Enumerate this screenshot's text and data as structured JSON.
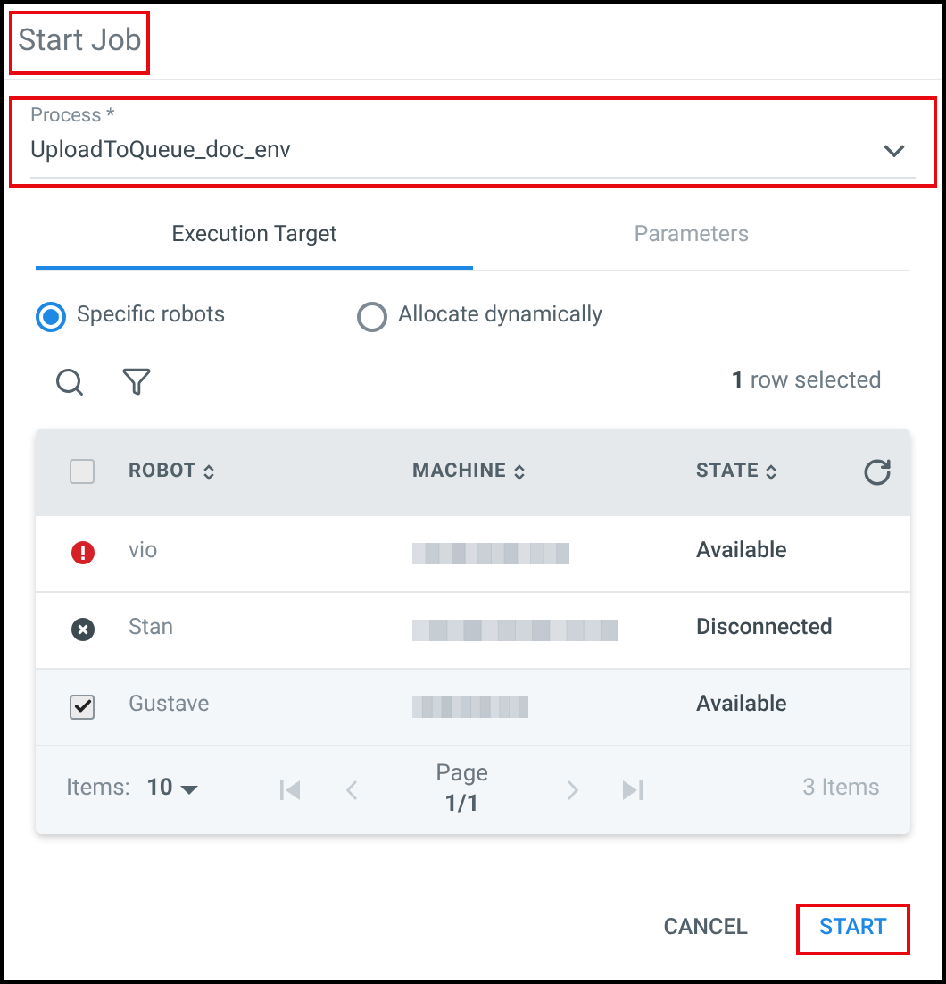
{
  "dialog": {
    "title": "Start Job",
    "highlighted": true
  },
  "process": {
    "label": "Process *",
    "value": "UploadToQueue_doc_env",
    "highlighted": true
  },
  "tabs": [
    {
      "label": "Execution Target",
      "selected": true
    },
    {
      "label": "Parameters",
      "selected": false
    }
  ],
  "radios": [
    {
      "label": "Specific robots",
      "selected": true
    },
    {
      "label": "Allocate dynamically",
      "selected": false
    }
  ],
  "selection": {
    "count": "1",
    "text": "row selected"
  },
  "table": {
    "columns": [
      "ROBOT",
      "MACHINE",
      "STATE"
    ],
    "header_checkbox": {
      "checked": false
    },
    "rows": [
      {
        "kind": "error",
        "selected": false,
        "robot": "vio",
        "machine": {
          "kind": "redacted"
        },
        "state": "Available"
      },
      {
        "kind": "disconnected",
        "selected": false,
        "robot": "Stan",
        "machine": {
          "kind": "redacted"
        },
        "state": "Disconnected"
      },
      {
        "kind": "checkbox",
        "selected": true,
        "robot": "Gustave",
        "machine": {
          "kind": "redacted"
        },
        "state": "Available"
      }
    ]
  },
  "pager": {
    "items_label": "Items:",
    "page_size": "10",
    "page_label": "Page",
    "page": "1/1",
    "total": "3 Items",
    "nav": [
      {
        "kind": "first",
        "disabled": true
      },
      {
        "kind": "prev",
        "disabled": true
      },
      {
        "kind": "next",
        "disabled": true
      },
      {
        "kind": "last",
        "disabled": true
      }
    ]
  },
  "buttons": [
    {
      "label": "CANCEL",
      "kind": "text",
      "highlighted": false
    },
    {
      "label": "START",
      "kind": "primary",
      "highlighted": true
    }
  ]
}
